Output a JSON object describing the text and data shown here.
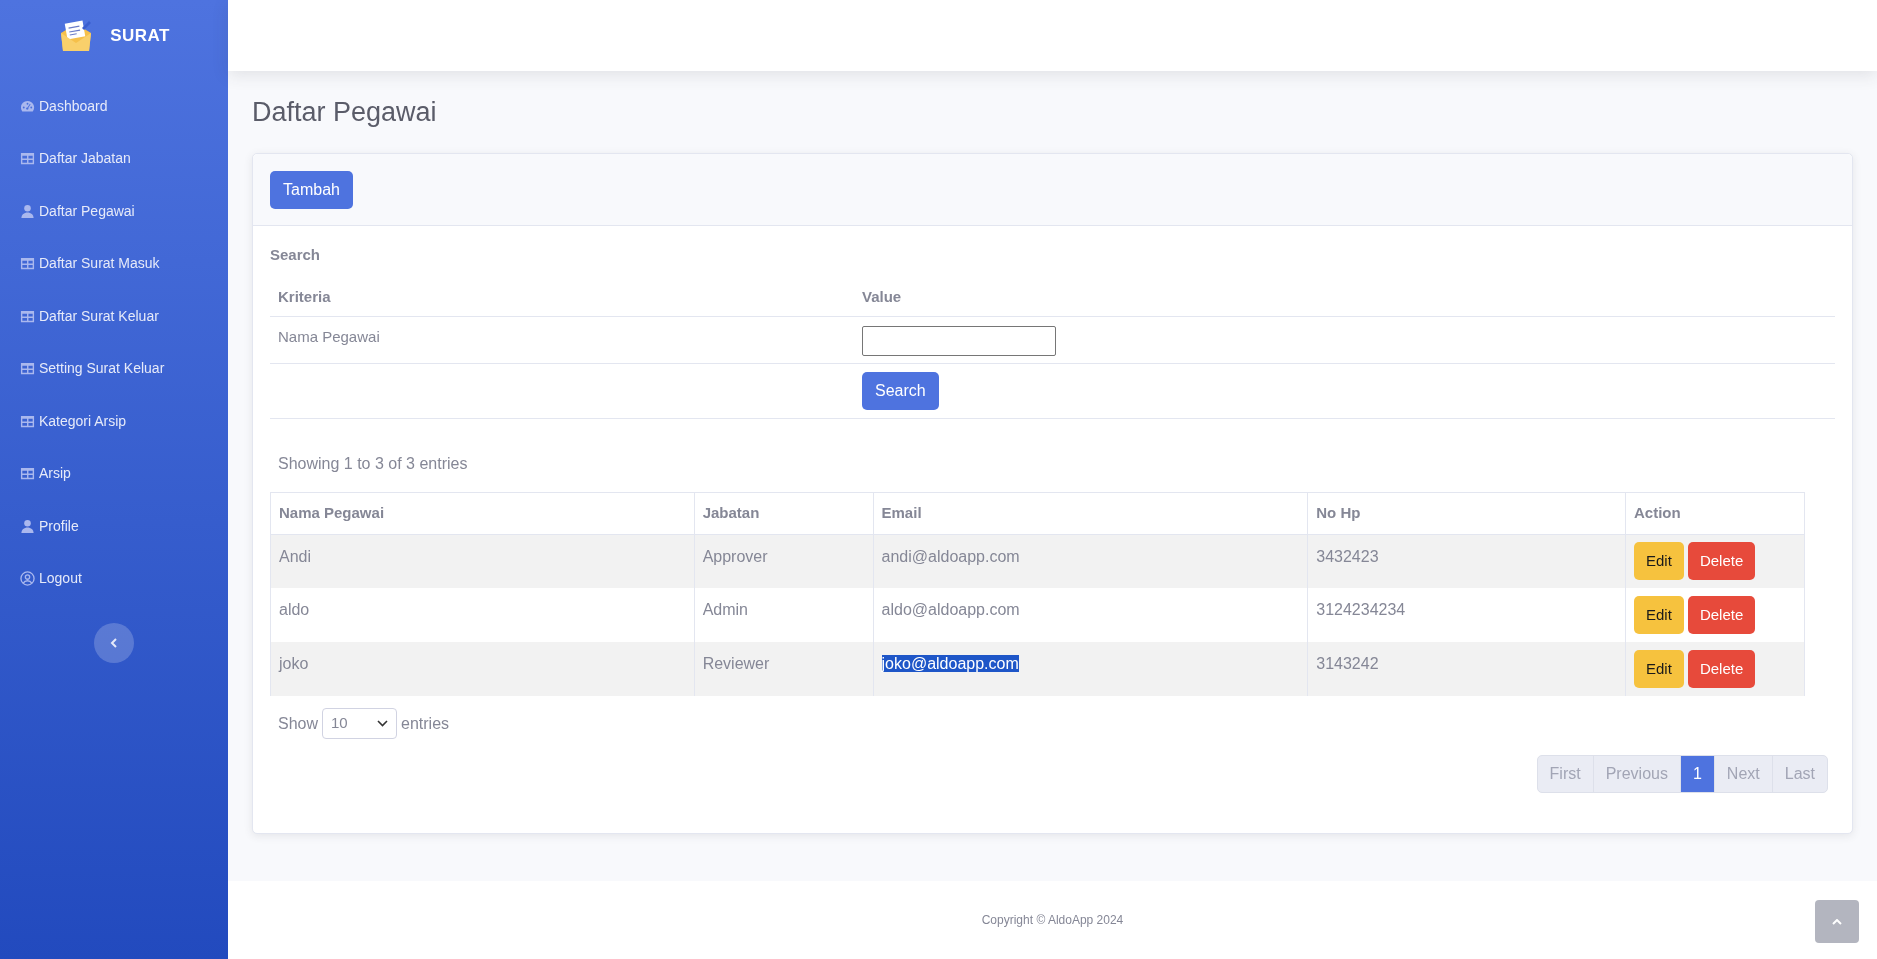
{
  "brand": {
    "title": "SURAT"
  },
  "sidebar": {
    "items": [
      {
        "label": "Dashboard",
        "kind": "gauge"
      },
      {
        "label": "Daftar Jabatan",
        "kind": "table"
      },
      {
        "label": "Daftar Pegawai",
        "kind": "user"
      },
      {
        "label": "Daftar Surat Masuk",
        "kind": "table"
      },
      {
        "label": "Daftar Surat Keluar",
        "kind": "table"
      },
      {
        "label": "Setting Surat Keluar",
        "kind": "table"
      },
      {
        "label": "Kategori Arsip",
        "kind": "table"
      },
      {
        "label": "Arsip",
        "kind": "table"
      },
      {
        "label": "Profile",
        "kind": "user"
      },
      {
        "label": "Logout",
        "kind": "user-circle"
      }
    ]
  },
  "page": {
    "title": "Daftar Pegawai"
  },
  "card": {
    "add_button": "Tambah",
    "search_title": "Search",
    "criteria_table": {
      "columns": [
        "Kriteria",
        "Value"
      ],
      "rows": [
        {
          "criteria": "Nama Pegawai",
          "value": ""
        }
      ],
      "search_button": "Search"
    },
    "info": "Showing 1 to 3 of 3 entries",
    "table": {
      "columns": [
        "Nama Pegawai",
        "Jabatan",
        "Email",
        "No Hp",
        "Action"
      ],
      "rows": [
        {
          "name": "Andi",
          "jabatan": "Approver",
          "email": "andi@aldoapp.com",
          "no_hp": "3432423",
          "email_highlighted": false,
          "actions": [
            "Edit",
            "Delete"
          ]
        },
        {
          "name": "aldo",
          "jabatan": "Admin",
          "email": "aldo@aldoapp.com",
          "no_hp": "3124234234",
          "email_highlighted": false,
          "actions": [
            "Edit",
            "Delete"
          ]
        },
        {
          "name": "joko",
          "jabatan": "Reviewer",
          "email": "joko@aldoapp.com",
          "no_hp": "3143242",
          "email_highlighted": true,
          "actions": [
            "Edit",
            "Delete"
          ]
        }
      ]
    },
    "length": {
      "before": "Show",
      "value": "10",
      "after": "entries"
    },
    "pagination": [
      {
        "label": "First",
        "selected": false
      },
      {
        "label": "Previous",
        "selected": false
      },
      {
        "label": "1",
        "selected": true
      },
      {
        "label": "Next",
        "selected": false
      },
      {
        "label": "Last",
        "selected": false
      }
    ]
  },
  "footer": {
    "copyright": "Copyright © AldoApp 2024"
  }
}
